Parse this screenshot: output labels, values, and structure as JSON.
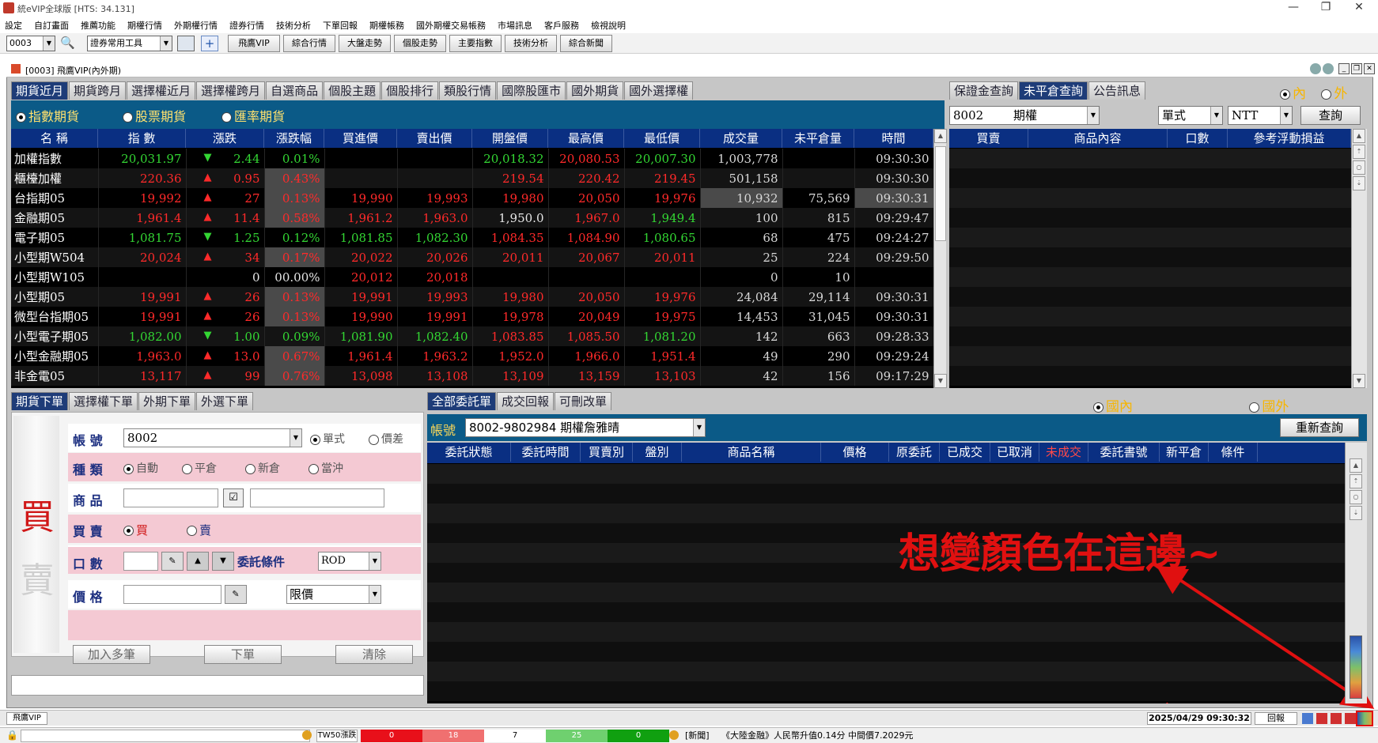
{
  "window": {
    "title": "統eVIP全球版 [HTS: 34.131]",
    "controls": [
      "—",
      "❐",
      "✕"
    ]
  },
  "menu": [
    "設定",
    "自訂畫面",
    "推薦功能",
    "期權行情",
    "外期權行情",
    "證券行情",
    "技術分析",
    "下單回報",
    "期權帳務",
    "國外期權交易帳務",
    "市場訊息",
    "客戶服務",
    "檢視說明"
  ],
  "toolbar": {
    "code": "0003",
    "tool_combo": "證券常用工具",
    "buttons": [
      "飛鷹VIP",
      "綜合行情",
      "大盤走勢",
      "個股走勢",
      "主要指數",
      "技術分析",
      "綜合新聞"
    ]
  },
  "inner": {
    "title": "[0003] 飛鷹VIP(內外期)"
  },
  "quote": {
    "tabs": [
      "期貨近月",
      "期貨跨月",
      "選擇權近月",
      "選擇權跨月",
      "自選商品",
      "個股主題",
      "個股排行",
      "類股行情",
      "國際股匯市",
      "國外期貨",
      "國外選擇權"
    ],
    "radios": [
      "指數期貨",
      "股票期貨",
      "匯率期貨"
    ],
    "headers": [
      "名 稱",
      "指 數",
      "漲跌",
      "漲跌幅",
      "買進價",
      "賣出價",
      "開盤價",
      "最高價",
      "最低價",
      "成交量",
      "未平倉量",
      "時間"
    ],
    "rows": [
      {
        "name": "加權指數",
        "idx": "20,031.97",
        "dir": "▼",
        "chg": "2.44",
        "pct": "0.01%",
        "bid": "",
        "ask": "",
        "open": "20,018.32",
        "high": "20,080.53",
        "low": "20,007.30",
        "vol": "1,003,778",
        "oi": "",
        "time": "09:30:30",
        "c": [
          "dn",
          "dn",
          "dn",
          "dn",
          "",
          "",
          "dn",
          "up",
          "dn"
        ]
      },
      {
        "name": "櫃檯加權",
        "idx": "220.36",
        "dir": "▲",
        "chg": "0.95",
        "pct": "0.43%",
        "bid": "",
        "ask": "",
        "open": "219.54",
        "high": "220.42",
        "low": "219.45",
        "vol": "501,158",
        "oi": "",
        "time": "09:30:30",
        "c": [
          "up",
          "up",
          "up",
          "up",
          "",
          "",
          "up",
          "up",
          "up"
        ]
      },
      {
        "name": "台指期05",
        "idx": "19,992",
        "dir": "▲",
        "chg": "27",
        "pct": "0.13%",
        "bid": "19,990",
        "ask": "19,993",
        "open": "19,980",
        "high": "20,050",
        "low": "19,976",
        "vol": "10,932",
        "oi": "75,569",
        "time": "09:30:31",
        "c": [
          "up",
          "up",
          "up",
          "up",
          "up",
          "up",
          "up",
          "up",
          "up"
        ]
      },
      {
        "name": "金融期05",
        "idx": "1,961.4",
        "dir": "▲",
        "chg": "11.4",
        "pct": "0.58%",
        "bid": "1,961.2",
        "ask": "1,963.0",
        "open": "1,950.0",
        "high": "1,967.0",
        "low": "1,949.4",
        "vol": "100",
        "oi": "815",
        "time": "09:29:47",
        "c": [
          "up",
          "up",
          "up",
          "up",
          "up",
          "up",
          "ye",
          "up",
          "dn"
        ]
      },
      {
        "name": "電子期05",
        "idx": "1,081.75",
        "dir": "▼",
        "chg": "1.25",
        "pct": "0.12%",
        "bid": "1,081.85",
        "ask": "1,082.30",
        "open": "1,084.35",
        "high": "1,084.90",
        "low": "1,080.65",
        "vol": "68",
        "oi": "475",
        "time": "09:24:27",
        "c": [
          "dn",
          "dn",
          "dn",
          "dn",
          "dn",
          "dn",
          "up",
          "up",
          "dn"
        ]
      },
      {
        "name": "小型期W504",
        "idx": "20,024",
        "dir": "▲",
        "chg": "34",
        "pct": "0.17%",
        "bid": "20,022",
        "ask": "20,026",
        "open": "20,011",
        "high": "20,067",
        "low": "20,011",
        "vol": "25",
        "oi": "224",
        "time": "09:29:50",
        "c": [
          "up",
          "up",
          "up",
          "up",
          "up",
          "up",
          "up",
          "up",
          "up"
        ]
      },
      {
        "name": "小型期W105",
        "idx": "",
        "dir": "",
        "chg": "0",
        "pct": "00.00%",
        "bid": "20,012",
        "ask": "20,018",
        "open": "",
        "high": "",
        "low": "",
        "vol": "0",
        "oi": "10",
        "time": "",
        "c": [
          "ye",
          "ye",
          "ye",
          "ye",
          "up",
          "up",
          "",
          "",
          ""
        ]
      },
      {
        "name": "小型期05",
        "idx": "19,991",
        "dir": "▲",
        "chg": "26",
        "pct": "0.13%",
        "bid": "19,991",
        "ask": "19,993",
        "open": "19,980",
        "high": "20,050",
        "low": "19,976",
        "vol": "24,084",
        "oi": "29,114",
        "time": "09:30:31",
        "c": [
          "up",
          "up",
          "up",
          "up",
          "up",
          "up",
          "up",
          "up",
          "up"
        ]
      },
      {
        "name": "微型台指期05",
        "idx": "19,991",
        "dir": "▲",
        "chg": "26",
        "pct": "0.13%",
        "bid": "19,990",
        "ask": "19,991",
        "open": "19,978",
        "high": "20,049",
        "low": "19,975",
        "vol": "14,453",
        "oi": "31,045",
        "time": "09:30:31",
        "c": [
          "up",
          "up",
          "up",
          "up",
          "up",
          "up",
          "up",
          "up",
          "up"
        ]
      },
      {
        "name": "小型電子期05",
        "idx": "1,082.00",
        "dir": "▼",
        "chg": "1.00",
        "pct": "0.09%",
        "bid": "1,081.90",
        "ask": "1,082.40",
        "open": "1,083.85",
        "high": "1,085.50",
        "low": "1,081.20",
        "vol": "142",
        "oi": "663",
        "time": "09:28:33",
        "c": [
          "dn",
          "dn",
          "dn",
          "dn",
          "dn",
          "dn",
          "up",
          "up",
          "dn"
        ]
      },
      {
        "name": "小型金融期05",
        "idx": "1,963.0",
        "dir": "▲",
        "chg": "13.0",
        "pct": "0.67%",
        "bid": "1,961.4",
        "ask": "1,963.2",
        "open": "1,952.0",
        "high": "1,966.0",
        "low": "1,951.4",
        "vol": "49",
        "oi": "290",
        "time": "09:29:24",
        "c": [
          "up",
          "up",
          "up",
          "up",
          "up",
          "up",
          "up",
          "up",
          "up"
        ]
      },
      {
        "name": "非金電05",
        "idx": "13,117",
        "dir": "▲",
        "chg": "99",
        "pct": "0.76%",
        "bid": "13,098",
        "ask": "13,108",
        "open": "13,109",
        "high": "13,159",
        "low": "13,103",
        "vol": "42",
        "oi": "156",
        "time": "09:17:29",
        "c": [
          "up",
          "up",
          "up",
          "up",
          "up",
          "up",
          "up",
          "up",
          "up"
        ]
      }
    ]
  },
  "positions": {
    "tabs": [
      "保證金查詢",
      "未平倉查詢",
      "公告訊息"
    ],
    "radio_in": "內",
    "radio_out": "外",
    "account": "8002",
    "type": "期權",
    "mode": "單式",
    "currency": "NTT",
    "query_button": "查詢",
    "headers": [
      "買賣",
      "商品內容",
      "口數",
      "參考浮動損益"
    ]
  },
  "order": {
    "tabs": [
      "期貨下單",
      "選擇權下單",
      "外期下單",
      "外選下單"
    ],
    "buy_label": "買",
    "sell_label": "賣",
    "account_label": "帳 號",
    "account": "8002",
    "single": "單式",
    "spread": "價差",
    "kind_label": "種 類",
    "kinds": [
      "自動",
      "平倉",
      "新倉",
      "當沖"
    ],
    "product_label": "商 品",
    "side_label": "買 賣",
    "side_buy": "買",
    "side_sell": "賣",
    "qty_label": "口 數",
    "cond_label": "委託條件",
    "cond_value": "ROD",
    "price_label": "價 格",
    "price_type": "限價",
    "btn_add": "加入多筆",
    "btn_submit": "下單",
    "btn_clear": "清除"
  },
  "orders": {
    "tabs": [
      "全部委託單",
      "成交回報",
      "可刪改單"
    ],
    "radio_in": "國內",
    "radio_out": "國外",
    "account_label": "帳號",
    "account": "8002-9802984 期權詹雅晴",
    "refresh_button": "重新查詢",
    "headers": [
      "委託狀態",
      "委託時間",
      "買賣別",
      "盤別",
      "商品名稱",
      "價格",
      "原委託",
      "已成交",
      "已取消",
      "未成交",
      "委託書號",
      "新平倉",
      "條件"
    ]
  },
  "annotation": {
    "text": "想變顏色在這邊~",
    "color": "#e01010"
  },
  "status": {
    "app": "飛鷹VIP",
    "datetime": "2025/04/29 09:30:32",
    "receipt": "回報",
    "tw50_label": "TW50漲跌",
    "tw50": [
      {
        "v": "0",
        "bg": "#e8101a",
        "fg": "#ffffff"
      },
      {
        "v": "18",
        "bg": "#f07070",
        "fg": "#ffffff"
      },
      {
        "v": "7",
        "bg": "#ffffff",
        "fg": "#000000"
      },
      {
        "v": "25",
        "bg": "#6fd06f",
        "fg": "#ffffff"
      },
      {
        "v": "0",
        "bg": "#10a010",
        "fg": "#ffffff"
      }
    ],
    "news_label": "[新聞]",
    "news": "《大陸金融》人民幣升值0.14分 中間價7.2029元"
  }
}
